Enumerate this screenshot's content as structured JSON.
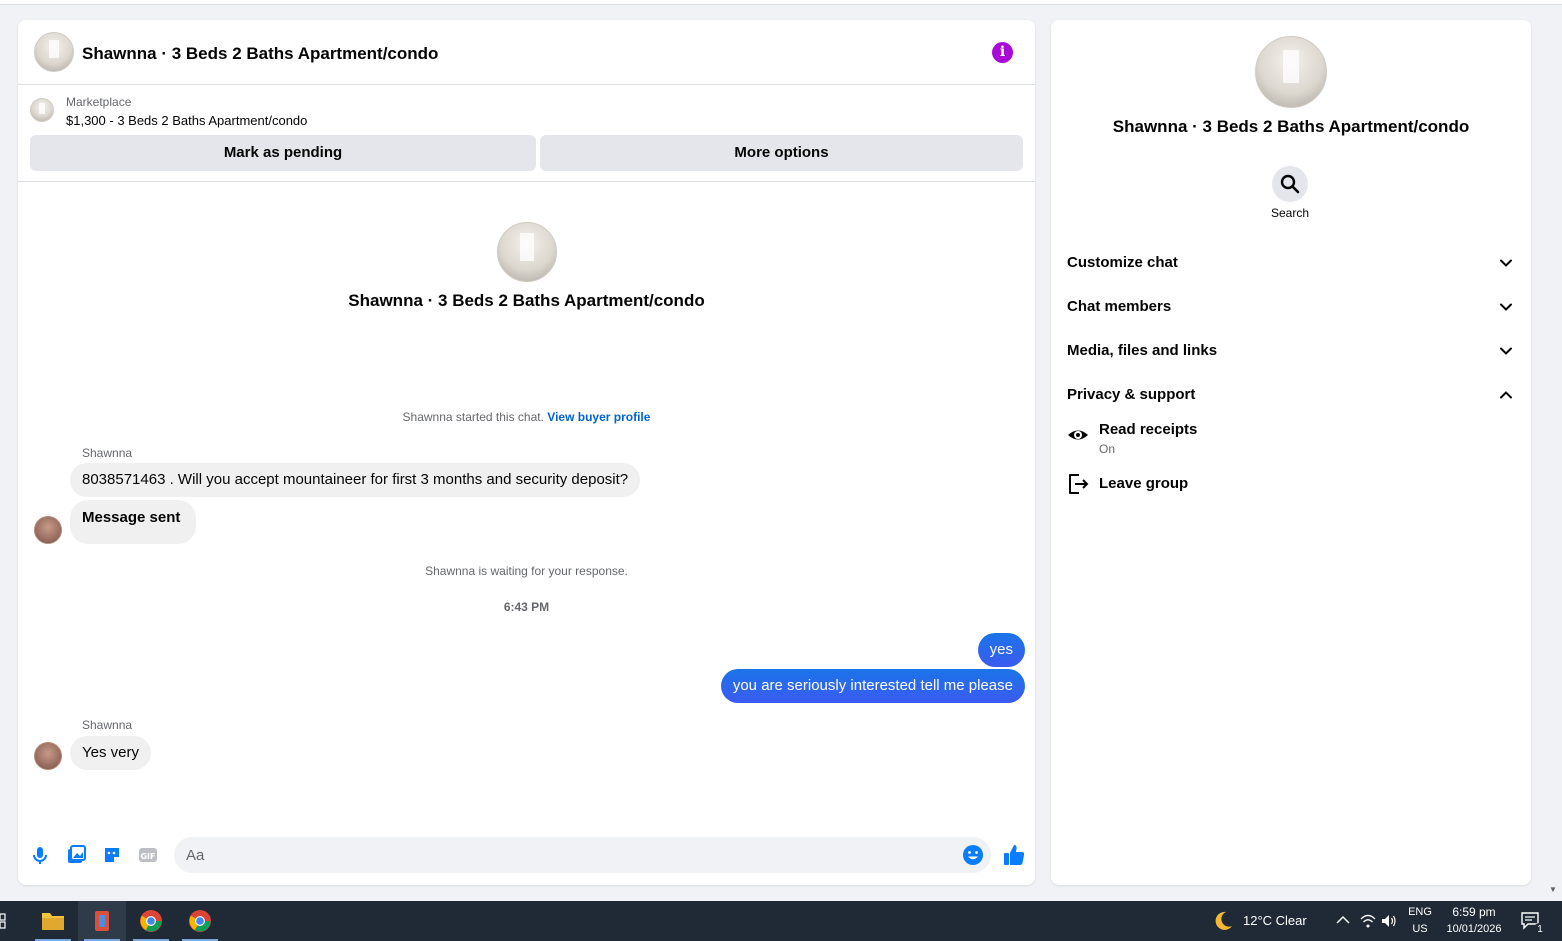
{
  "chat": {
    "title": "Shawnna · 3 Beds 2 Baths Apartment/condo",
    "marketplace_label": "Marketplace",
    "listing": "$1,300 - 3 Beds 2 Baths Apartment/condo",
    "mark_pending_label": "Mark as pending",
    "more_options_label": "More options",
    "intro_title": "Shawnna · 3 Beds 2 Baths Apartment/condo",
    "started_text": "Shawnna started this chat.",
    "view_buyer_profile": "View buyer profile",
    "messages": [
      {
        "sender": "Shawnna",
        "text": "8038571463 . Will you accept mountaineer for first 3 months and security deposit?"
      },
      {
        "text": "Message sent"
      },
      {
        "text": "yes"
      },
      {
        "text": "you are seriously interested tell me please"
      },
      {
        "sender": "Shawnna",
        "text": "Yes very"
      }
    ],
    "waiting_text": "Shawnna is waiting for your response.",
    "timestamp": "6:43 PM",
    "composer_placeholder": "Aa"
  },
  "info": {
    "title": "Shawnna · 3 Beds 2 Baths Apartment/condo",
    "search_label": "Search",
    "sections": [
      {
        "label": "Customize chat",
        "expanded": false
      },
      {
        "label": "Chat members",
        "expanded": false
      },
      {
        "label": "Media, files and links",
        "expanded": false
      },
      {
        "label": "Privacy & support",
        "expanded": true
      }
    ],
    "read_receipts_label": "Read receipts",
    "read_receipts_value": "On",
    "leave_group_label": "Leave group"
  },
  "taskbar": {
    "weather": "12°C  Clear",
    "lang_top": "ENG",
    "lang_bottom": "US",
    "time": "6:59 pm",
    "date": "10/01/2026",
    "notifications": "1"
  },
  "colors": {
    "accent": "#0a7cff",
    "info_icon": "#a80bd8",
    "link": "#0064d1",
    "taskbar": "#1f2a36"
  }
}
